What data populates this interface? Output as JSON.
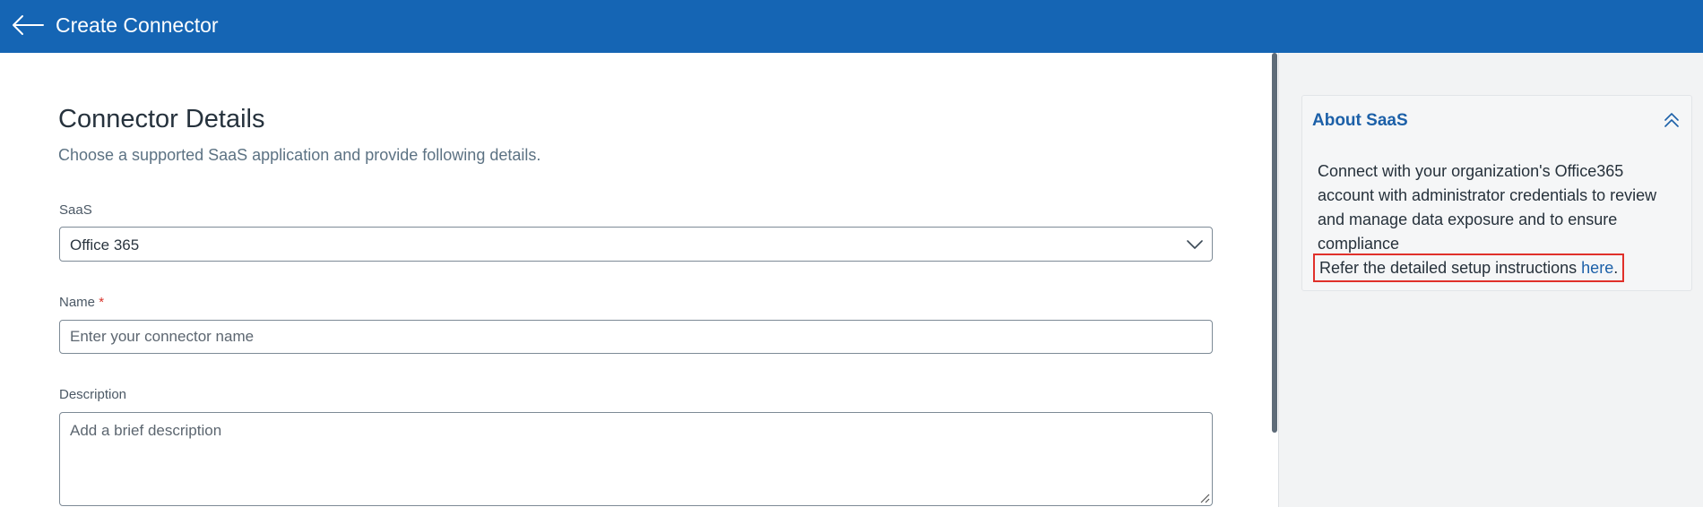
{
  "header": {
    "title": "Create Connector",
    "back_icon": "arrow-left-icon",
    "background": "#1565b4"
  },
  "form": {
    "section_title": "Connector Details",
    "section_subtitle": "Choose a supported SaaS application and provide following details.",
    "saas": {
      "label": "SaaS",
      "value": "Office 365"
    },
    "name": {
      "label": "Name",
      "required_marker": "*",
      "placeholder": "Enter your connector name",
      "value": ""
    },
    "description": {
      "label": "Description",
      "placeholder": "Add a brief description",
      "value": ""
    }
  },
  "about": {
    "title": "About SaaS",
    "body": "Connect with your organization's Office365 account with administrator credentials to review and manage data exposure and to ensure compliance",
    "refer_text": "Refer the detailed setup instructions ",
    "link_text": "here",
    "link_suffix": ".",
    "accent": "#1c60a8",
    "highlight_color": "#e0302a"
  }
}
